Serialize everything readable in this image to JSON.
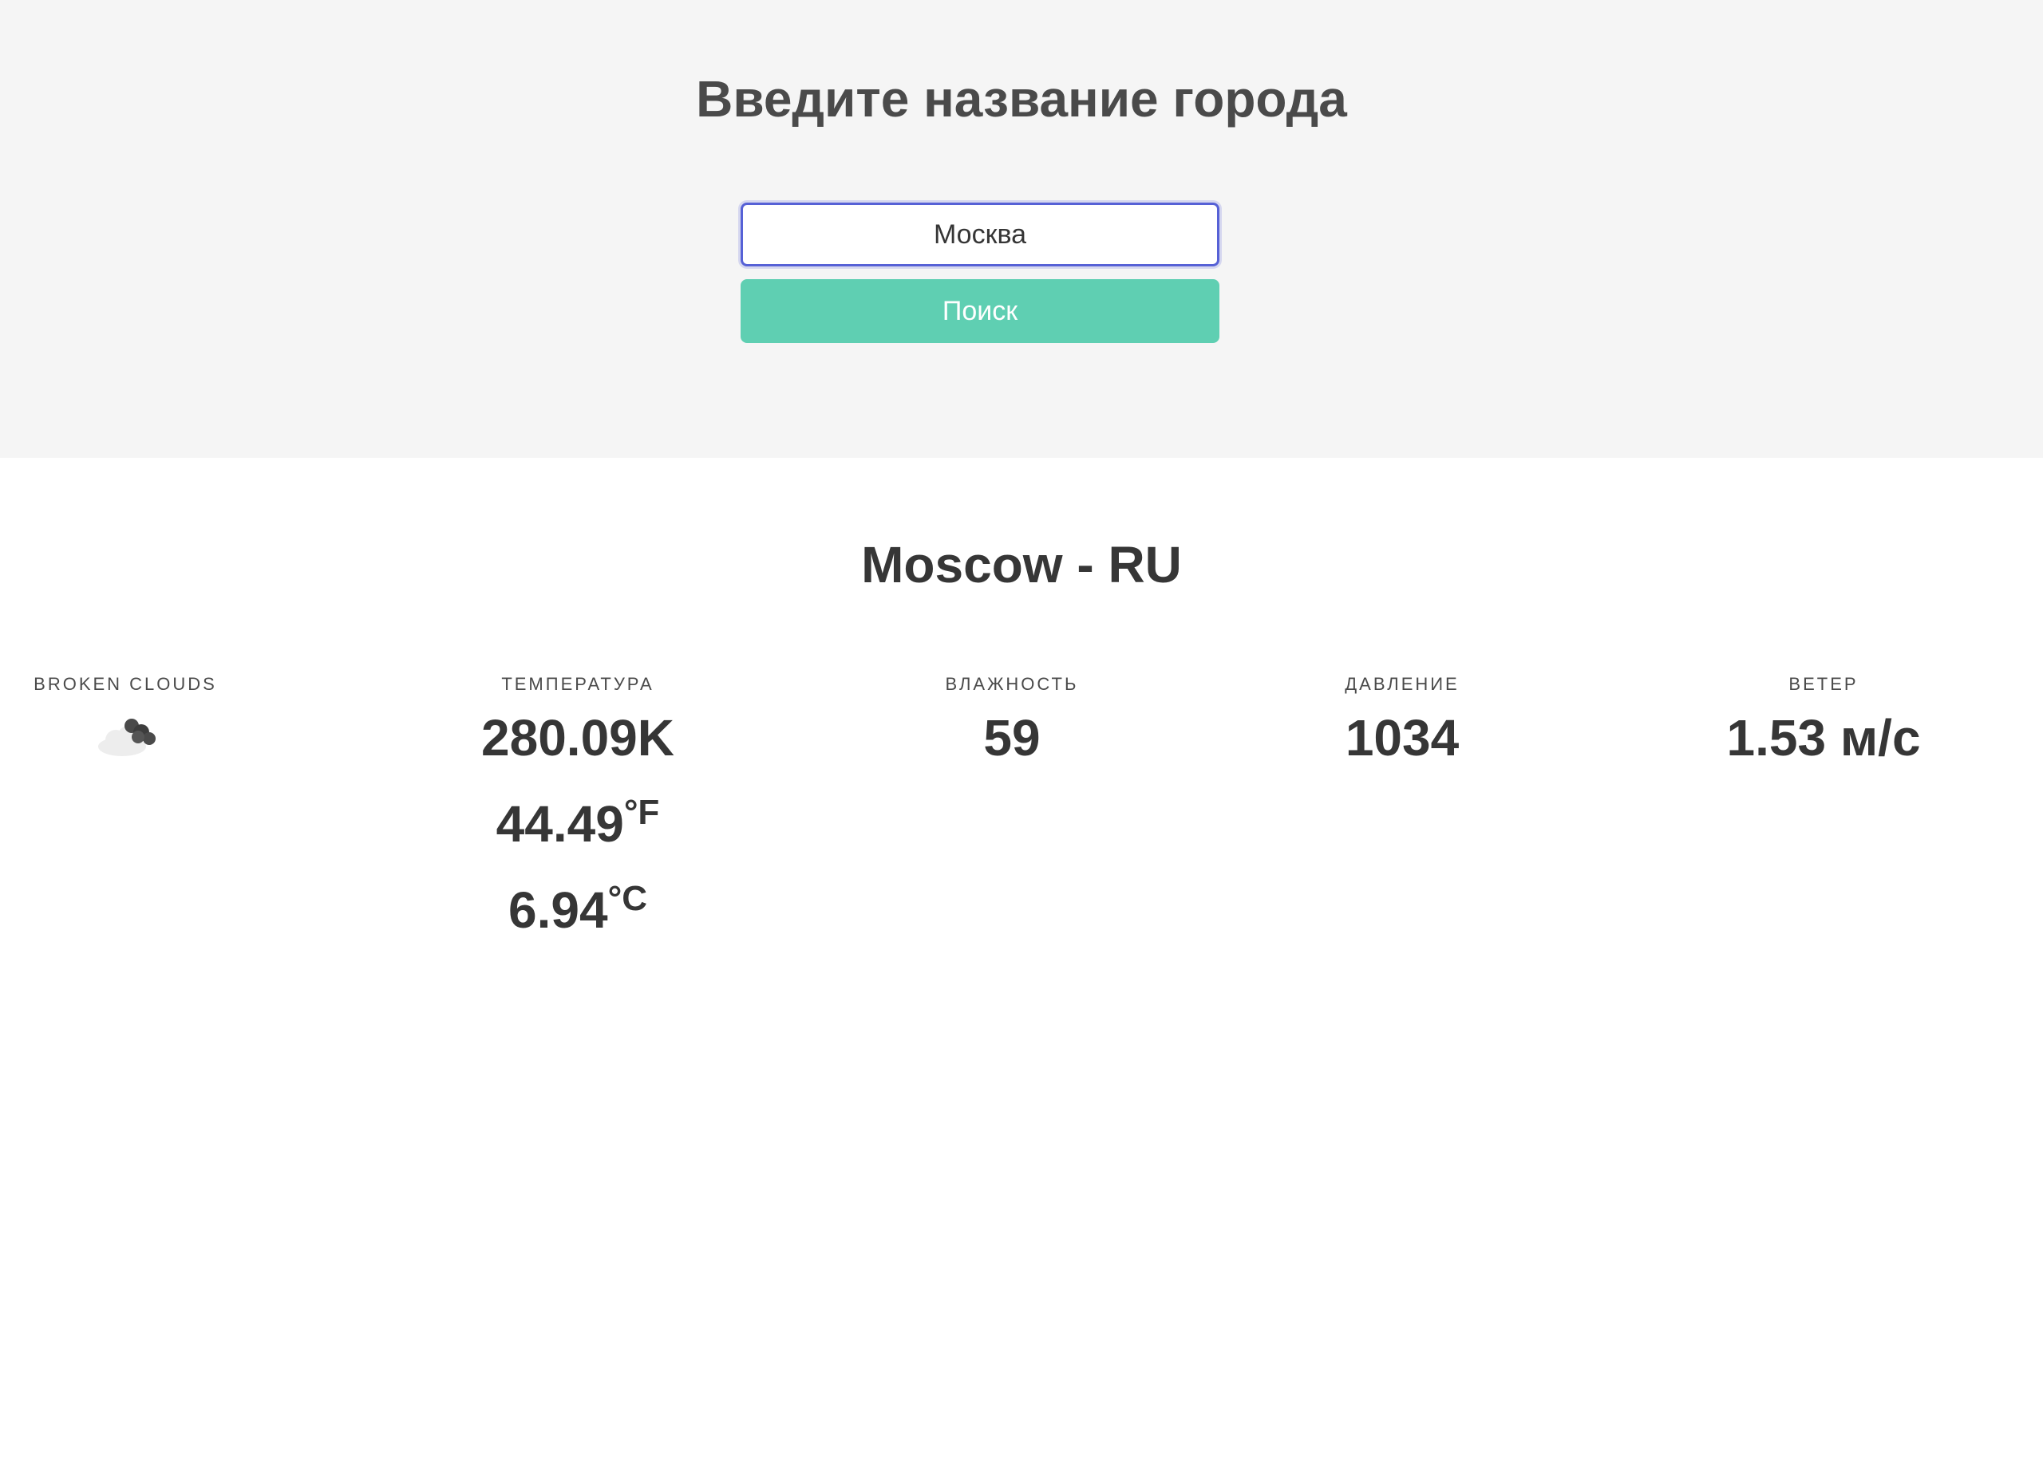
{
  "search": {
    "title": "Введите название города",
    "input_value": "Москва",
    "button_label": "Поиск"
  },
  "result": {
    "city": "Moscow - RU",
    "description": {
      "label": "broken clouds",
      "icon": "broken-clouds-icon"
    },
    "temperature": {
      "label": "температура",
      "kelvin": "280.09K",
      "fahrenheit": "44.49",
      "fahrenheit_unit": "°F",
      "celsius": "6.94",
      "celsius_unit": "°C"
    },
    "humidity": {
      "label": "влажность",
      "value": "59"
    },
    "pressure": {
      "label": "давление",
      "value": "1034"
    },
    "wind": {
      "label": "ветер",
      "value": "1.53 м/с"
    }
  },
  "colors": {
    "search_background": "#f5f5f5",
    "button": "#5fcfb2",
    "input_border": "#5661d6",
    "text": "#363636"
  }
}
